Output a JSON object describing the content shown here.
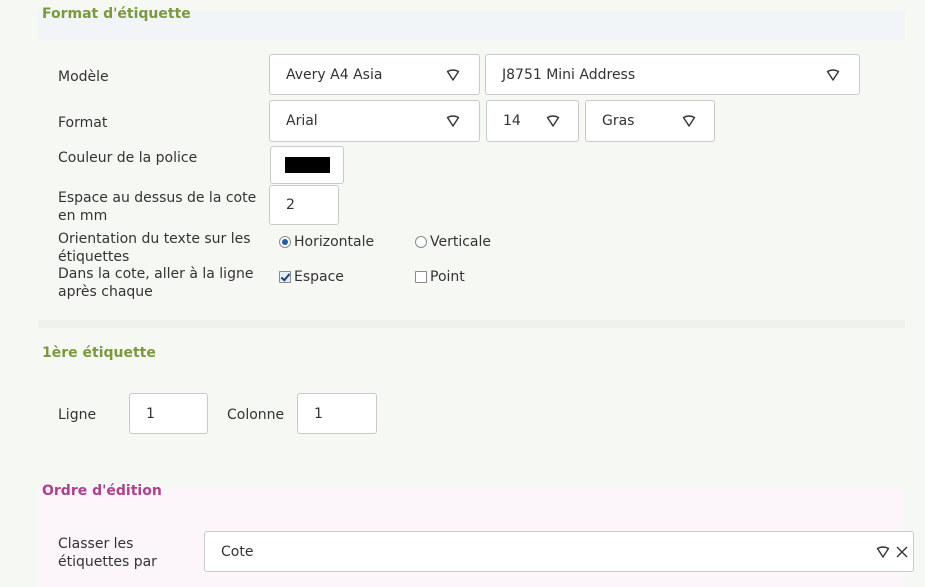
{
  "sections": {
    "label_format": {
      "title": "Format d'étiquette"
    },
    "first_label": {
      "title": "1ère étiquette"
    },
    "print_order": {
      "title": "Ordre d'édition"
    }
  },
  "model": {
    "label": "Modèle",
    "brand": "Avery A4 Asia",
    "reference": "J8751 Mini Address"
  },
  "format": {
    "label": "Format",
    "font": "Arial",
    "size": "14",
    "weight": "Gras"
  },
  "font_color": {
    "label": "Couleur de la police",
    "value": "#000000"
  },
  "space_above": {
    "label_line1": "Espace au dessus de la cote",
    "label_line2": "en mm",
    "value": "2"
  },
  "orientation": {
    "label_line1": "Orientation du texte sur les",
    "label_line2": "étiquettes",
    "options": [
      {
        "label": "Horizontale",
        "selected": true
      },
      {
        "label": "Verticale",
        "selected": false
      }
    ]
  },
  "line_break": {
    "label_line1": "Dans la cote, aller à la ligne",
    "label_line2": "après chaque",
    "options": [
      {
        "label": "Espace",
        "checked": true
      },
      {
        "label": "Point",
        "checked": false
      }
    ]
  },
  "first_label": {
    "row_label": "Ligne",
    "row_value": "1",
    "col_label": "Colonne",
    "col_value": "1"
  },
  "sort": {
    "label_line1": "Classer les",
    "label_line2": "étiquettes par",
    "value": "Cote"
  },
  "colors": {
    "green_title": "#7a9a3a",
    "pink_title": "#b0408f",
    "page_bg": "#f6f9f3"
  },
  "icons": [
    "chevron-down-icon",
    "clear-icon",
    "radio-icon",
    "checkbox-icon"
  ]
}
